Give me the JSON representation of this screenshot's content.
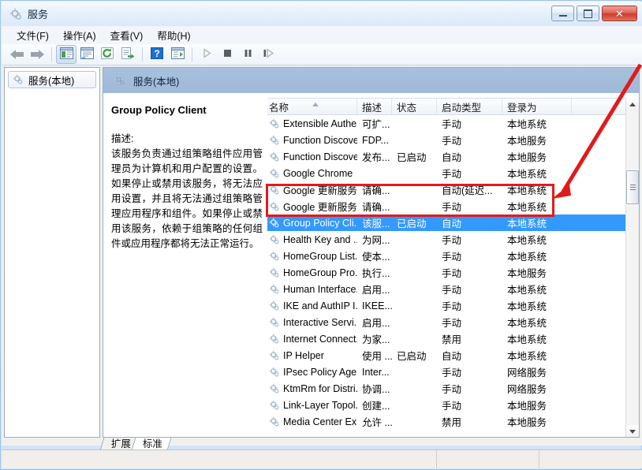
{
  "window": {
    "title": "服务",
    "icon": "service-gear-icon",
    "buttons": {
      "minimize": "minimize-icon",
      "maximize": "maximize-icon",
      "close": "✕"
    }
  },
  "menu": {
    "items": [
      {
        "label": "文件(F)",
        "name": "menu-file"
      },
      {
        "label": "操作(A)",
        "name": "menu-action"
      },
      {
        "label": "查看(V)",
        "name": "menu-view"
      },
      {
        "label": "帮助(H)",
        "name": "menu-help"
      }
    ]
  },
  "toolbar": {
    "items": [
      {
        "name": "back-arrow-icon",
        "kind": "back"
      },
      {
        "name": "forward-arrow-icon",
        "kind": "forward"
      },
      {
        "name": "show-hide-tree-icon",
        "kind": "tree",
        "pressed": true
      },
      {
        "name": "properties-icon",
        "kind": "properties"
      },
      {
        "name": "refresh-icon",
        "kind": "refresh"
      },
      {
        "name": "export-list-icon",
        "kind": "export"
      },
      {
        "name": "help-icon",
        "kind": "help"
      },
      {
        "name": "show-action-pane-icon",
        "kind": "actionpane"
      },
      {
        "name": "start-service-icon",
        "kind": "play"
      },
      {
        "name": "stop-service-icon",
        "kind": "stop"
      },
      {
        "name": "pause-service-icon",
        "kind": "pause"
      },
      {
        "name": "restart-service-icon",
        "kind": "restart"
      }
    ]
  },
  "tree": {
    "root_label": "服务(本地)"
  },
  "pane": {
    "header_label": "服务(本地)"
  },
  "details": {
    "service_name": "Group Policy Client",
    "description_label": "描述:",
    "description_text": "该服务负责通过组策略组件应用管理员为计算机和用户配置的设置。如果停止或禁用该服务，将无法应用设置，并且将无法通过组策略管理应用程序和组件。如果停止或禁用该服务，依赖于组策略的任何组件或应用程序都将无法正常运行。"
  },
  "list": {
    "columns": [
      {
        "label": "名称",
        "name": "column-name",
        "sorted": "asc"
      },
      {
        "label": "描述",
        "name": "column-description"
      },
      {
        "label": "状态",
        "name": "column-status"
      },
      {
        "label": "启动类型",
        "name": "column-startup-type"
      },
      {
        "label": "登录为",
        "name": "column-log-on-as"
      }
    ],
    "rows": [
      {
        "name": "Extensible Authe...",
        "desc": "可扩...",
        "state": "",
        "startup": "手动",
        "logon": "本地系统",
        "selected": false
      },
      {
        "name": "Function Discove...",
        "desc": "FDP...",
        "state": "",
        "startup": "手动",
        "logon": "本地服务",
        "selected": false
      },
      {
        "name": "Function Discove...",
        "desc": "发布...",
        "state": "已启动",
        "startup": "自动",
        "logon": "本地服务",
        "selected": false
      },
      {
        "name": "Google Chrome",
        "desc": "",
        "state": "",
        "startup": "手动",
        "logon": "本地系统",
        "selected": false
      },
      {
        "name": "Google 更新服务...",
        "desc": "请确...",
        "state": "",
        "startup": "自动(延迟...",
        "logon": "本地系统",
        "selected": false
      },
      {
        "name": "Google 更新服务...",
        "desc": "请确...",
        "state": "",
        "startup": "手动",
        "logon": "本地系统",
        "selected": false
      },
      {
        "name": "Group Policy Cli...",
        "desc": "该服...",
        "state": "已启动",
        "startup": "自动",
        "logon": "本地系统",
        "selected": true
      },
      {
        "name": "Health Key and ...",
        "desc": "为网...",
        "state": "",
        "startup": "手动",
        "logon": "本地系统",
        "selected": false
      },
      {
        "name": "HomeGroup List...",
        "desc": "使本...",
        "state": "",
        "startup": "手动",
        "logon": "本地系统",
        "selected": false
      },
      {
        "name": "HomeGroup Pro...",
        "desc": "执行...",
        "state": "",
        "startup": "手动",
        "logon": "本地服务",
        "selected": false
      },
      {
        "name": "Human Interface...",
        "desc": "启用...",
        "state": "",
        "startup": "手动",
        "logon": "本地系统",
        "selected": false
      },
      {
        "name": "IKE and AuthIP I...",
        "desc": "IKEE...",
        "state": "",
        "startup": "手动",
        "logon": "本地系统",
        "selected": false
      },
      {
        "name": "Interactive Servi...",
        "desc": "启用...",
        "state": "",
        "startup": "手动",
        "logon": "本地系统",
        "selected": false
      },
      {
        "name": "Internet Connect...",
        "desc": "为家...",
        "state": "",
        "startup": "禁用",
        "logon": "本地系统",
        "selected": false
      },
      {
        "name": "IP Helper",
        "desc": "使用 ...",
        "state": "已启动",
        "startup": "自动",
        "logon": "本地系统",
        "selected": false
      },
      {
        "name": "IPsec Policy Agent",
        "desc": "Inter...",
        "state": "",
        "startup": "手动",
        "logon": "网络服务",
        "selected": false
      },
      {
        "name": "KtmRm for Distri...",
        "desc": "协调...",
        "state": "",
        "startup": "手动",
        "logon": "网络服务",
        "selected": false
      },
      {
        "name": "Link-Layer Topol...",
        "desc": "创建...",
        "state": "",
        "startup": "手动",
        "logon": "本地服务",
        "selected": false
      },
      {
        "name": "Media Center Ex...",
        "desc": "允许 ...",
        "state": "",
        "startup": "禁用",
        "logon": "本地服务",
        "selected": false
      }
    ]
  },
  "tabs": [
    {
      "label": "扩展",
      "name": "tab-extended",
      "active": false
    },
    {
      "label": "标准",
      "name": "tab-standard",
      "active": true
    }
  ],
  "annotations": {
    "highlight_color": "#e01b1b",
    "box_target": "Google 更新服务 rows",
    "arrow": "red-arrow-pointing-to-highlighted-rows"
  },
  "colors": {
    "selection": "#3399ff",
    "pane_header": "#a8c0dc",
    "annotation": "#e01b1b"
  }
}
